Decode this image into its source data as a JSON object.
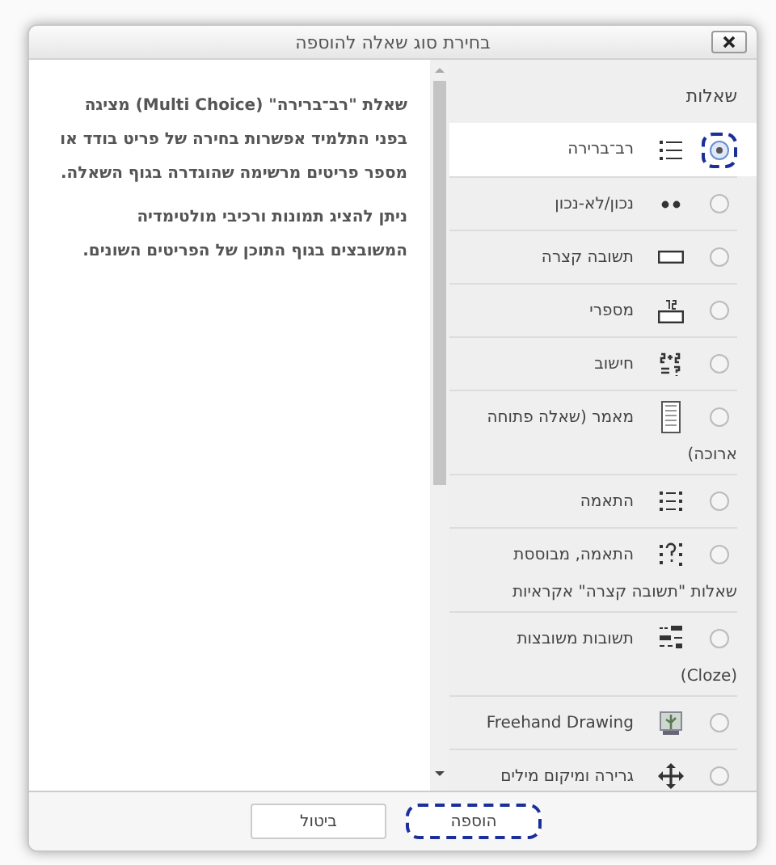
{
  "dialog": {
    "title": "בחירת סוג שאלה להוספה"
  },
  "list": {
    "heading": "שאלות",
    "items": [
      {
        "kind": "multichoice",
        "label": "רב־ברירה",
        "selected": true
      },
      {
        "kind": "truefalse",
        "label": "נכון/לא-נכון",
        "selected": false
      },
      {
        "kind": "shortanswer",
        "label": "תשובה קצרה",
        "selected": false
      },
      {
        "kind": "numerical",
        "label": "מספרי",
        "selected": false
      },
      {
        "kind": "calculated",
        "label": "חישוב",
        "selected": false
      },
      {
        "kind": "essay",
        "label": "מאמר (שאלה פתוחה",
        "label_continued": "ארוכה)",
        "selected": false
      },
      {
        "kind": "match",
        "label": "התאמה",
        "selected": false
      },
      {
        "kind": "randommatch",
        "label": "התאמה, מבוססת",
        "label_continued": "שאלות \"תשובה קצרה\" אקראיות",
        "selected": false
      },
      {
        "kind": "embedded",
        "label": "תשובות משובצות",
        "label_continued": "(Cloze)",
        "selected": false
      },
      {
        "kind": "freehand",
        "label": "Freehand Drawing",
        "selected": false
      },
      {
        "kind": "dragdrop",
        "label": "גרירה ומיקום מילים",
        "selected": false
      }
    ]
  },
  "description": [
    "שאלת \"רב־ברירה\" (Multi Choice) מציגה בפני התלמיד אפשרות בחירה של פריט בודד או מספר פריטים מרשימה שהוגדרה בגוף השאלה.",
    "ניתן להציג תמונות ורכיבי מולטימדיה המשובצים בגוף התוכן של הפריטים השונים."
  ],
  "buttons": [
    {
      "label": "הוספה",
      "focused": true
    },
    {
      "label": "ביטול",
      "focused": false
    }
  ]
}
